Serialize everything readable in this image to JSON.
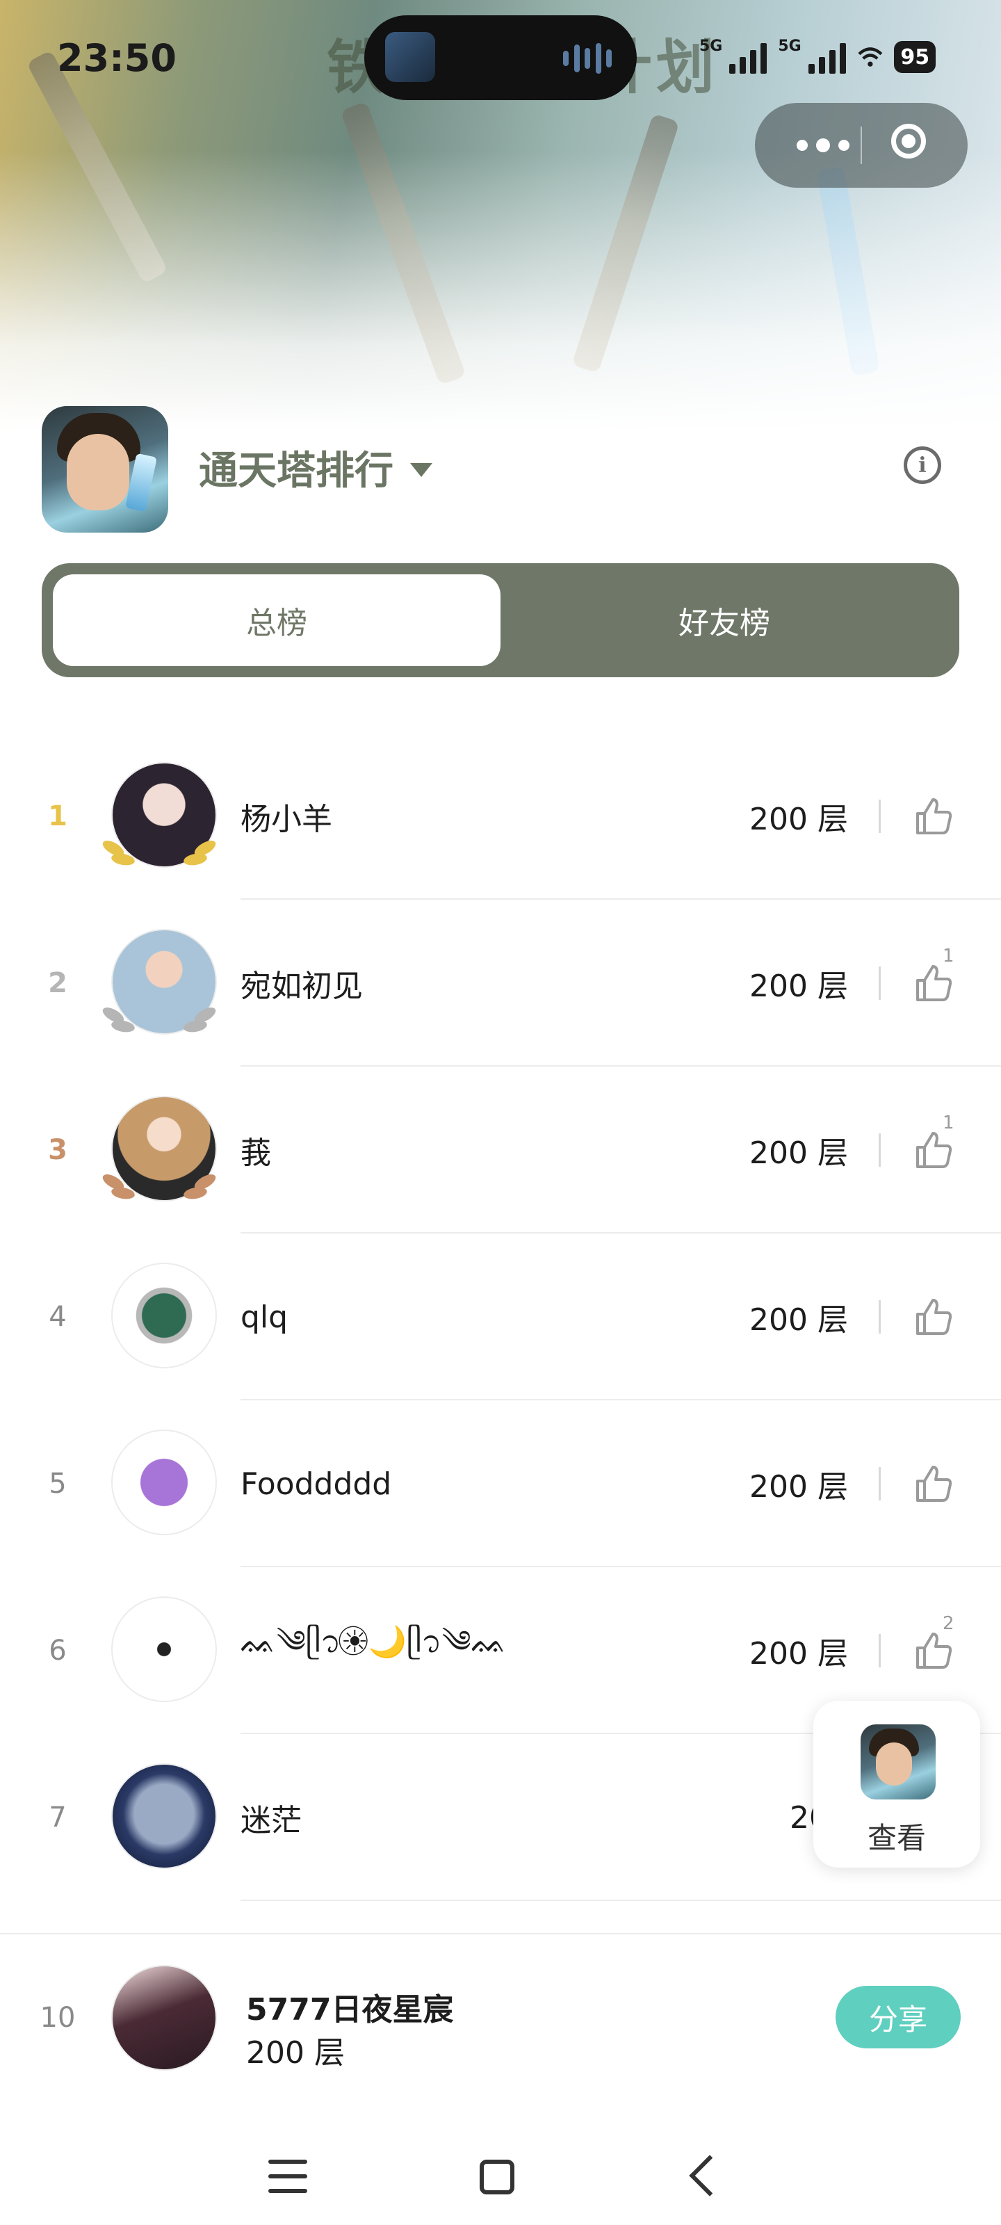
{
  "status_bar": {
    "time": "23:50",
    "network_1": "5G",
    "network_2": "5G",
    "battery": "95"
  },
  "banner": {
    "title": "铁...复兴计划"
  },
  "header": {
    "title": "通天塔排行",
    "info_icon": "info-icon"
  },
  "tabs": [
    {
      "label": "总榜",
      "active": true
    },
    {
      "label": "好友榜",
      "active": false
    }
  ],
  "ranking": [
    {
      "rank": "1",
      "name": "杨小羊",
      "score": "200 层",
      "likes": "",
      "avatar_color": "#3a3140"
    },
    {
      "rank": "2",
      "name": "宛如初见",
      "score": "200 层",
      "likes": "1",
      "avatar_color": "#a9c4d8"
    },
    {
      "rank": "3",
      "name": "莪",
      "score": "200 层",
      "likes": "1",
      "avatar_color": "#c79a6a"
    },
    {
      "rank": "4",
      "name": "qlq",
      "score": "200 层",
      "likes": "",
      "avatar_color": "#2e6b52"
    },
    {
      "rank": "5",
      "name": "Fooddddd",
      "score": "200 层",
      "likes": "",
      "avatar_color": "#a774d8"
    },
    {
      "rank": "6",
      "name": "ᨐ༄ᥫ᭡☀︎⃝🌙ᥫ᭡༄ᨐ",
      "score": "200 层",
      "likes": "2",
      "avatar_color": "#ffffff"
    },
    {
      "rank": "7",
      "name": "迷茫",
      "score": "200",
      "likes": "",
      "avatar_color": "#2a3a66"
    }
  ],
  "float_button": {
    "label": "查看"
  },
  "my_rank": {
    "rank": "10",
    "name": "5777日夜星宸",
    "score": "200 层",
    "share_label": "分享"
  },
  "colors": {
    "accent": "#6f7868",
    "share": "#5fcfbf",
    "gold": "#e7c34a",
    "silver": "#b5b5b5",
    "bronze": "#c8916a"
  }
}
